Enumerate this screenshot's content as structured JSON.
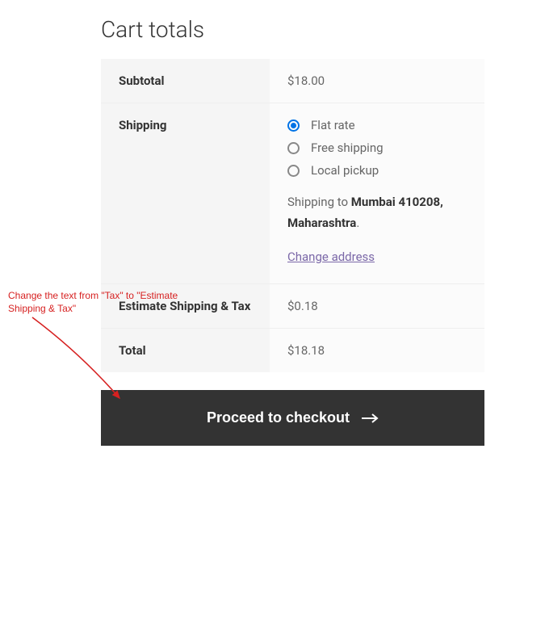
{
  "heading": "Cart totals",
  "rows": {
    "subtotal": {
      "label": "Subtotal",
      "value": "$18.00"
    },
    "shipping": {
      "label": "Shipping",
      "options": [
        {
          "label": "Flat rate",
          "selected": true
        },
        {
          "label": "Free shipping",
          "selected": false
        },
        {
          "label": "Local pickup",
          "selected": false
        }
      ],
      "destination_prefix": "Shipping to ",
      "destination_bold": "Mumbai 410208, Maharashtra",
      "destination_suffix": ".",
      "change_address": "Change address"
    },
    "tax": {
      "label": "Estimate Shipping & Tax",
      "value": "$0.18"
    },
    "total": {
      "label": "Total",
      "value": "$18.18"
    }
  },
  "checkout_button": "Proceed to checkout",
  "annotation": "Change the text from \"Tax\" to \"Estimate Shipping & Tax\""
}
